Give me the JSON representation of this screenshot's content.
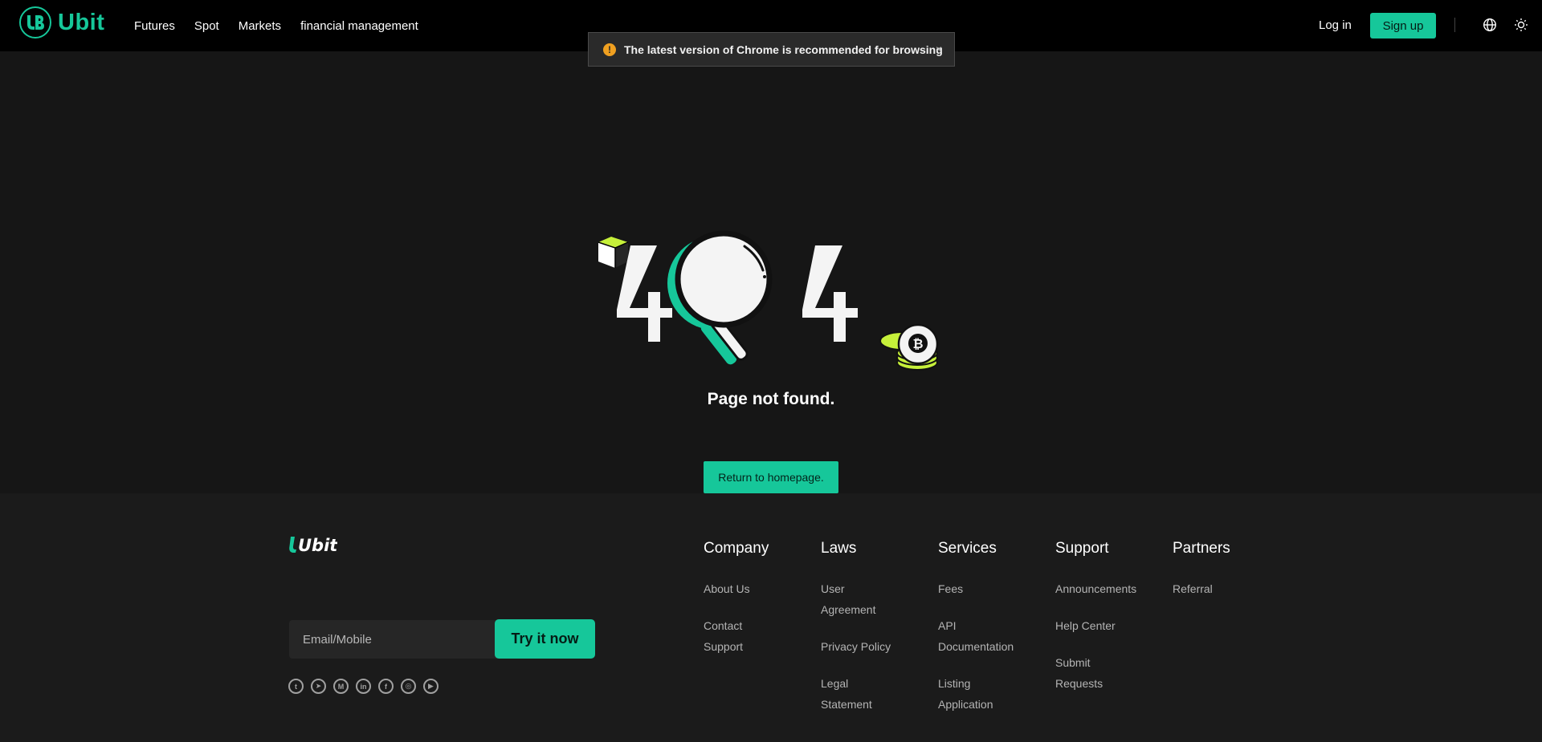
{
  "nav": {
    "brand": "Ubit",
    "links": [
      "Futures",
      "Spot",
      "Markets",
      "financial management"
    ],
    "login": "Log in",
    "signup": "Sign up",
    "icons": [
      "globe-icon",
      "sun-icon"
    ]
  },
  "notice": {
    "text": "The latest version of Chrome is recommended for browsing",
    "icon": "warning-icon",
    "close": "×"
  },
  "error": {
    "title": "Page not found.",
    "button": "Return to homepage."
  },
  "footer": {
    "brand": "Ubit",
    "email_placeholder": "Email/Mobile",
    "try": "Try it now",
    "socials": [
      "twitter-icon",
      "telegram-icon",
      "medium-icon",
      "linkedin-icon",
      "facebook-icon",
      "instagram-icon",
      "youtube-icon"
    ],
    "columns": [
      {
        "title": "Company",
        "items": [
          "About Us",
          "Contact Support"
        ]
      },
      {
        "title": "Laws",
        "items": [
          "User Agreement",
          "Privacy Policy",
          "Legal Statement"
        ]
      },
      {
        "title": "Services",
        "items": [
          "Fees",
          "API Documentation",
          "Listing Application"
        ]
      },
      {
        "title": "Support",
        "items": [
          "Announcements",
          "Help Center",
          "Submit Requests"
        ]
      },
      {
        "title": "Partners",
        "items": [
          "Referral"
        ]
      }
    ]
  },
  "colors": {
    "accent": "#16c79a",
    "background": "#161616",
    "nav_bg": "#000000",
    "footer_bg": "#1b1b1b",
    "lime": "#c6f03a"
  }
}
